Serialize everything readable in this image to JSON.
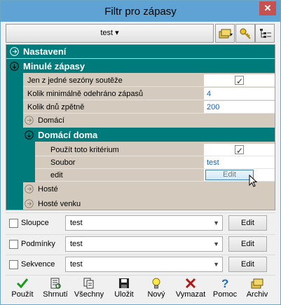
{
  "window": {
    "title": "Filtr pro zápasy",
    "close_label": "✕"
  },
  "toolbar": {
    "filter_label": "test ▾"
  },
  "tree": {
    "nastaveni": "Nastavení",
    "minule": "Minulé zápasy",
    "props": [
      {
        "name": "Jen z jedné sezóny soutěže",
        "value": ""
      },
      {
        "name": "Kolik minimálně odehráno zápasů",
        "value": "4"
      },
      {
        "name": "Kolik dnů zpětně",
        "value": "200"
      }
    ],
    "domaci": "Domácí",
    "domaci_doma": "Domácí doma",
    "sub_props": [
      {
        "name": "Použít toto kritérium",
        "value": ""
      },
      {
        "name": "Soubor",
        "value": "test"
      },
      {
        "name": "edit",
        "value": "Edit"
      }
    ],
    "hoste": "Hosté",
    "hoste_venku": "Hosté venku"
  },
  "rows": [
    {
      "label": "Sloupce",
      "value": "test",
      "edit": "Edit"
    },
    {
      "label": "Podmínky",
      "value": "test",
      "edit": "Edit"
    },
    {
      "label": "Sekvence",
      "value": "test",
      "edit": "Edit"
    }
  ],
  "bottom": {
    "pouzit": "Použít",
    "shrnuti": "Shrnutí",
    "vsechny": "Všechny",
    "ulozit": "Uložit",
    "novy": "Nový",
    "vymazat": "Vymazat",
    "pomoc": "Pomoc",
    "archiv": "Archiv"
  }
}
